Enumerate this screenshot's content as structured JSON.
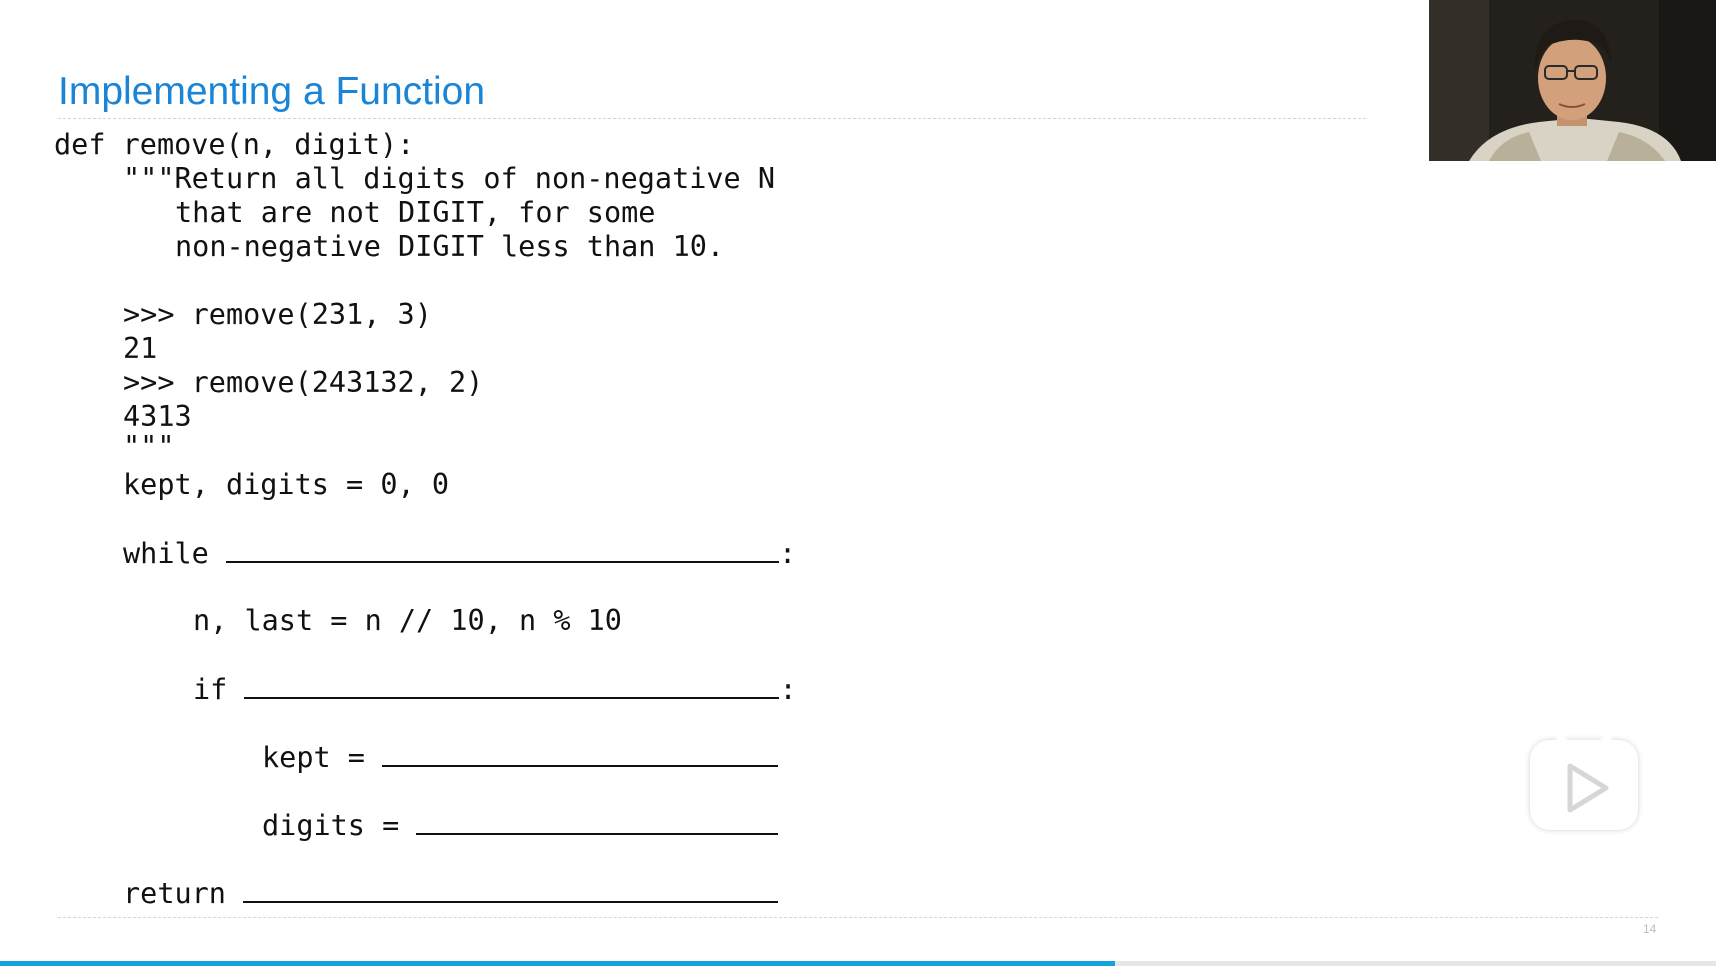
{
  "slide": {
    "title": "Implementing a Function",
    "page_number": "14"
  },
  "code": {
    "line_def": "def remove(n, digit):",
    "doc_1": "\"\"\"Return all digits of non-negative N",
    "doc_2": "that are not DIGIT, for some",
    "doc_3": "non-negative DIGIT less than 10.",
    "ex1_prompt": ">>> remove(231, 3)",
    "ex1_result": "21",
    "ex2_prompt": ">>> remove(243132, 2)",
    "ex2_result": "4313",
    "doc_close": "\"\"\"",
    "init": "kept, digits = 0, 0",
    "while_kw": "while ",
    "while_colon": ":",
    "split": "n, last = n // 10, n % 10",
    "if_kw": "if ",
    "if_colon": ":",
    "kept_assign": "kept = ",
    "digits_assign": "digits = ",
    "return_kw": "return "
  },
  "colors": {
    "title": "#1a85d6",
    "progress": "#14a3de"
  },
  "video": {
    "play_icon": "play-icon",
    "progress_fraction": 0.65
  }
}
